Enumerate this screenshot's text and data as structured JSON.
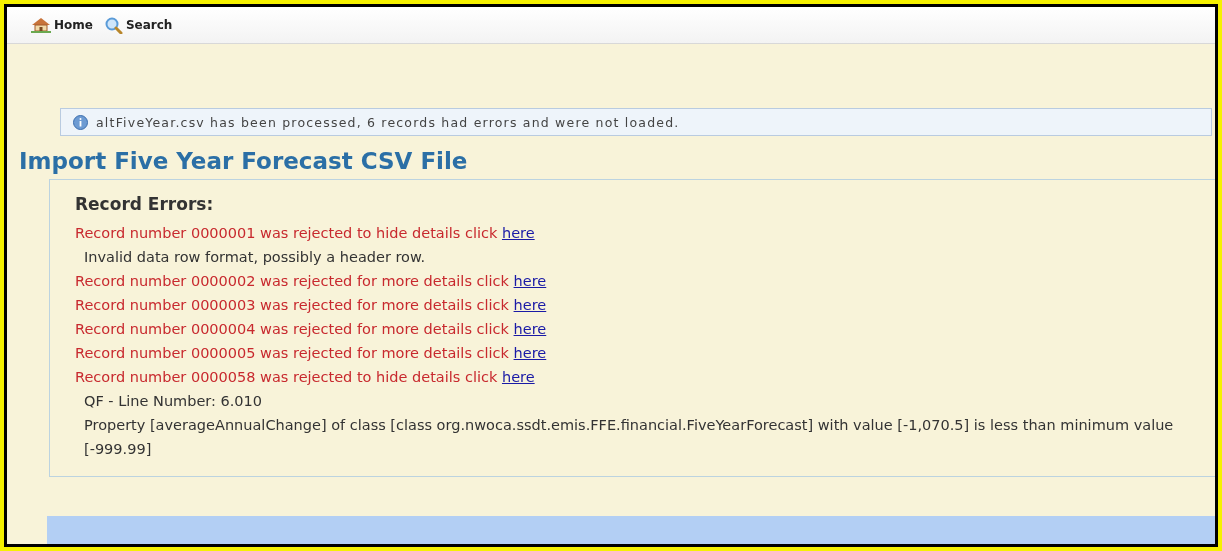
{
  "nav": [
    {
      "kind": "home",
      "label": "Home"
    },
    {
      "kind": "search",
      "label": "Search"
    }
  ],
  "message": {
    "text": "altFiveYear.csv has been processed, 6 records had errors and were not loaded."
  },
  "title": "Import Five Year Forecast CSV File",
  "panel": {
    "heading": "Record Errors:",
    "records": [
      {
        "text": "Record number 0000001 was rejected to hide details click",
        "link": "here",
        "details": [
          "Invalid data row format, possibly a header row."
        ]
      },
      {
        "text": "Record number 0000002 was rejected for more details click",
        "link": "here"
      },
      {
        "text": "Record number 0000003 was rejected for more details click",
        "link": "here"
      },
      {
        "text": "Record number 0000004 was rejected for more details click",
        "link": "here"
      },
      {
        "text": "Record number 0000005 was rejected for more details click",
        "link": "here"
      },
      {
        "text": "Record number 0000058 was rejected to hide details click",
        "link": "here",
        "details": [
          "QF - Line Number: 6.010",
          "Property [averageAnnualChange] of class [class org.nwoca.ssdt.emis.FFE.financial.FiveYearForecast] with value [-1,070.5] is less than minimum value [-999.99]"
        ]
      }
    ]
  }
}
